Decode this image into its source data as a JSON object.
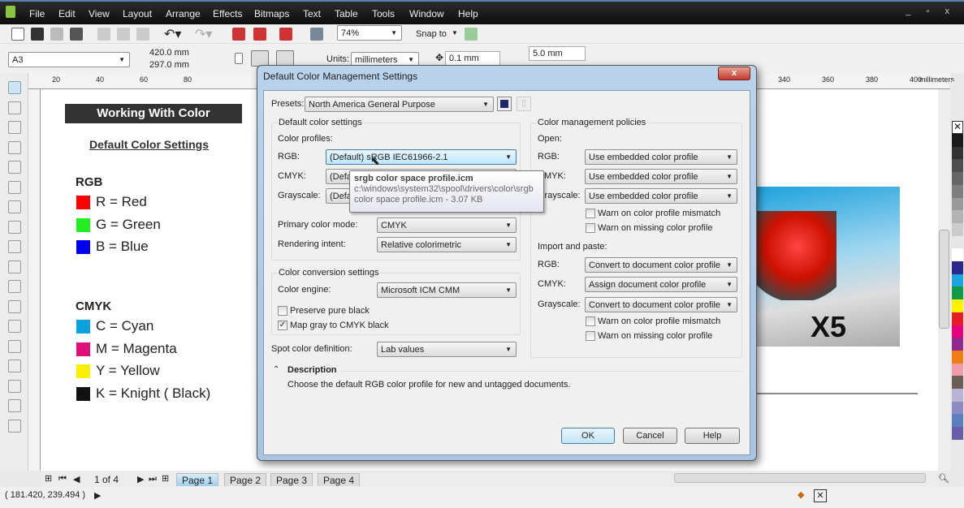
{
  "menu": [
    "File",
    "Edit",
    "View",
    "Layout",
    "Arrange",
    "Effects",
    "Bitmaps",
    "Text",
    "Table",
    "Tools",
    "Window",
    "Help"
  ],
  "toolbar": {
    "zoom": "74%",
    "snap_to": "Snap to"
  },
  "property_bar": {
    "page_size": "A3",
    "width": "420.0 mm",
    "height": "297.0 mm",
    "units_label": "Units:",
    "units": "millimeters",
    "nudge": "0.1 mm",
    "dup_x": "5.0 mm"
  },
  "ruler": {
    "ticks": [
      "20",
      "40",
      "60",
      "80",
      "340",
      "360",
      "380",
      "400"
    ],
    "unit": "millimeters"
  },
  "document": {
    "title": "Working With Color",
    "subtitle": "Default Color Settings",
    "rgb_heading": "RGB",
    "rgb": [
      {
        "label": "R = Red",
        "color": "#ff0000"
      },
      {
        "label": "G = Green",
        "color": "#22ee22"
      },
      {
        "label": "B = Blue",
        "color": "#0000ee"
      }
    ],
    "cmyk_heading": "CMYK",
    "cmyk": [
      {
        "label": "C = Cyan",
        "color": "#0aa0e0"
      },
      {
        "label": "M = Magenta",
        "color": "#e0107a"
      },
      {
        "label": "Y = Yellow",
        "color": "#f8f000"
      },
      {
        "label": "K = Knight ( Black)",
        "color": "#111111"
      }
    ],
    "image_text": "X5"
  },
  "dialog": {
    "title": "Default Color Management Settings",
    "close": "x",
    "presets_label": "Presets:",
    "preset": "North America General Purpose",
    "default_group": "Default color settings",
    "profiles_label": "Color profiles:",
    "rgb_label": "RGB:",
    "rgb_value": "(Default) sRGB IEC61966-2.1",
    "cmyk_label": "CMYK:",
    "cmyk_value": "(Default)",
    "gray_label": "Grayscale:",
    "gray_value": "(Default)",
    "primary_label": "Primary color mode:",
    "primary_value": "CMYK",
    "intent_label": "Rendering intent:",
    "intent_value": "Relative colorimetric",
    "conversion_group": "Color conversion settings",
    "engine_label": "Color engine:",
    "engine_value": "Microsoft ICM CMM",
    "preserve_black": {
      "label": "Preserve pure black",
      "checked": false
    },
    "map_gray": {
      "label": "Map gray to CMYK black",
      "checked": true
    },
    "spot_label": "Spot color definition:",
    "spot_value": "Lab values",
    "policies_group": "Color management policies",
    "open_label": "Open:",
    "open": {
      "rgb": "Use embedded color profile",
      "cmyk": "Use embedded color profile",
      "gray": "Use embedded color profile",
      "warn_mismatch": "Warn on color profile mismatch",
      "warn_missing": "Warn on missing color profile"
    },
    "import_label": "Import and paste:",
    "import": {
      "rgb": "Convert to document color profile",
      "cmyk": "Assign document color profile",
      "gray": "Convert to document color profile",
      "warn_mismatch": "Warn on color profile mismatch",
      "warn_missing": "Warn on missing color profile"
    },
    "description_label": "Description",
    "description": "Choose the default RGB color profile for new and untagged documents.",
    "ok": "OK",
    "cancel": "Cancel",
    "help": "Help",
    "tooltip": {
      "title": "srgb color space profile.icm",
      "path": "c:\\windows\\system32\\spool\\drivers\\color\\srgb",
      "size": "color space profile.icm - 3.07 KB"
    }
  },
  "pages": {
    "counter": "1 of 4",
    "tabs": [
      "Page 1",
      "Page 2",
      "Page 3",
      "Page 4"
    ]
  },
  "status": {
    "coords": "( 181.420, 239.494 )"
  },
  "palette": [
    "#1a1a1a",
    "#333",
    "#4d4d4d",
    "#666",
    "#7f7f7f",
    "#999",
    "#b3b3b3",
    "#ccc",
    "#e6e6e6",
    "#fff",
    "#2b2a8c",
    "#1aa3e0",
    "#129a48",
    "#fff200",
    "#e81c24",
    "#e6007e",
    "#92278f",
    "#f07c14",
    "#f29ca8",
    "#6d5c54",
    "#b9b3d6",
    "#8e8bc2",
    "#5b7fc1",
    "#6a5ca8"
  ]
}
